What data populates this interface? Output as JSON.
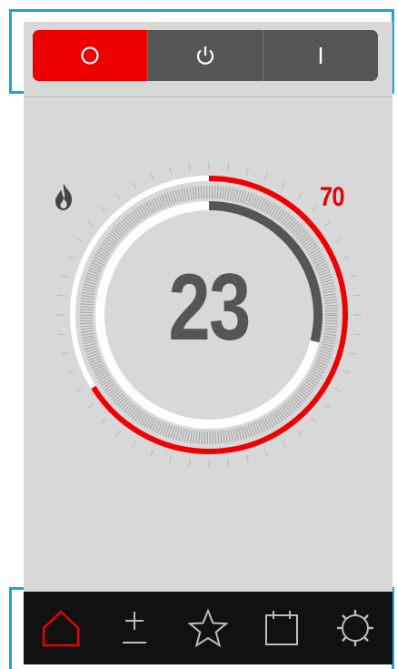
{
  "mode_bar": {
    "modes": [
      {
        "icon": "circle-off-icon",
        "active": true
      },
      {
        "icon": "power-icon",
        "active": false
      },
      {
        "icon": "on-bar-icon",
        "active": false
      }
    ]
  },
  "thermostat": {
    "current_temperature": "23",
    "setpoint": "70",
    "heating_icon": "flame-icon"
  },
  "nav": {
    "items": [
      {
        "icon": "home-icon",
        "active": true
      },
      {
        "icon": "plus-minus-icon",
        "active": false
      },
      {
        "icon": "star-icon",
        "active": false
      },
      {
        "icon": "calendar-icon",
        "active": false
      },
      {
        "icon": "gear-icon",
        "active": false
      }
    ]
  },
  "colors": {
    "accent": "#ee0000",
    "panel": "#d8d8d8",
    "dark": "#555555",
    "nav_bg": "#111111"
  }
}
